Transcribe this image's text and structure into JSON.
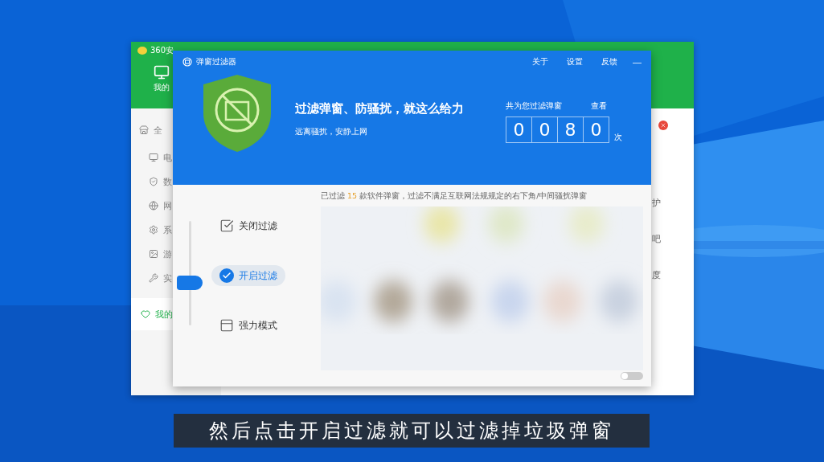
{
  "back_window": {
    "title": "360安",
    "tab_label": "我的",
    "sidebar_items": [
      {
        "label": "全",
        "kind": "all",
        "selected": false
      },
      {
        "label": "电",
        "kind": "device",
        "selected": false
      },
      {
        "label": "数",
        "kind": "security",
        "selected": false
      },
      {
        "label": "网",
        "kind": "network",
        "selected": false
      },
      {
        "label": "系",
        "kind": "system",
        "selected": false
      },
      {
        "label": "游",
        "kind": "game",
        "selected": false
      },
      {
        "label": "实",
        "kind": "tool",
        "selected": false
      },
      {
        "label": "我的",
        "kind": "favorite",
        "selected": true
      }
    ],
    "right_labels": [
      "护",
      "吧",
      "度"
    ]
  },
  "filter_window": {
    "title": "弹窗过滤器",
    "menu": [
      "关于",
      "设置",
      "反馈"
    ],
    "minimize": "—",
    "headline": "过滤弹窗、防骚扰，就这么给力",
    "subline": "远离骚扰，安静上网",
    "counter_label": "共为您过滤弹窗",
    "view_link": "查看",
    "digits": [
      "0",
      "0",
      "8",
      "0"
    ],
    "counter_unit": "次",
    "modes": [
      {
        "label": "关闭过滤",
        "kind": "off",
        "selected": false
      },
      {
        "label": "开启过滤",
        "kind": "on",
        "selected": true
      },
      {
        "label": "强力模式",
        "kind": "strong",
        "selected": false
      }
    ],
    "notice_prefix": "已过滤",
    "notice_count": "15",
    "notice_suffix": "款软件弹窗，过滤不满足互联网法规规定的右下角/中间骚扰弹窗",
    "toggle": {
      "on": false
    }
  },
  "subtitle": "然后点击开启过滤就可以过滤掉垃圾弹窗"
}
